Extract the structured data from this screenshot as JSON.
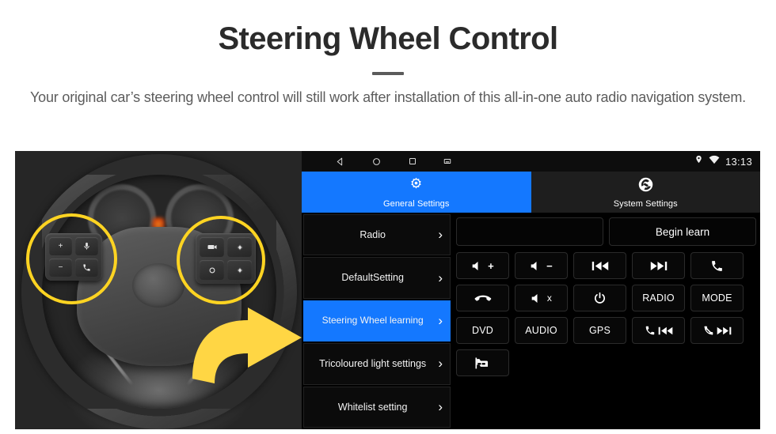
{
  "header": {
    "title": "Steering Wheel Control",
    "subtitle": "Your original car’s steering wheel control will still work after installation of this all-in-one auto radio navigation system."
  },
  "colors": {
    "accent_blue": "#1478ff",
    "highlight_yellow": "#FFD422",
    "arrow_yellow": "#FFD644",
    "screen_black": "#000000",
    "title_gray": "#2b2b2b",
    "subtitle_gray": "#5c5c5c"
  },
  "photo": {
    "caption": "steering-wheel-with-controls",
    "left_cluster_keys": [
      "+",
      "voice-assist",
      "−",
      "call"
    ],
    "right_cluster_keys": [
      "media",
      "up",
      "mode",
      "down"
    ]
  },
  "android": {
    "statusbar": {
      "nav": [
        "back-icon",
        "home-icon",
        "recents-icon",
        "screenshot-icon"
      ],
      "indicators": [
        "location-icon",
        "wifi-icon"
      ],
      "clock": "13:13"
    },
    "tabs": [
      {
        "label": "General Settings",
        "icon": "gear-icon",
        "active": true
      },
      {
        "label": "System Settings",
        "icon": "system-logo-icon",
        "active": false
      }
    ],
    "sidebar": [
      {
        "label": "Radio",
        "selected": false
      },
      {
        "label": "DefaultSetting",
        "selected": false
      },
      {
        "label": "Steering Wheel learning",
        "selected": true
      },
      {
        "label": "Tricoloured light settings",
        "selected": false
      },
      {
        "label": "Whitelist setting",
        "selected": false
      }
    ],
    "learn": {
      "display_value": "",
      "begin_label": "Begin learn"
    },
    "buttons": [
      [
        {
          "label": "",
          "icon": "volume-up-icon"
        },
        {
          "label": "",
          "icon": "volume-down-icon"
        },
        {
          "label": "",
          "icon": "previous-track-icon"
        },
        {
          "label": "",
          "icon": "next-track-icon"
        },
        {
          "label": "",
          "icon": "call-answer-icon"
        }
      ],
      [
        {
          "label": "",
          "icon": "call-hangup-icon"
        },
        {
          "label": "",
          "icon": "mute-icon"
        },
        {
          "label": "",
          "icon": "power-icon"
        },
        {
          "label": "RADIO",
          "icon": ""
        },
        {
          "label": "MODE",
          "icon": ""
        }
      ],
      [
        {
          "label": "DVD",
          "icon": ""
        },
        {
          "label": "AUDIO",
          "icon": ""
        },
        {
          "label": "GPS",
          "icon": ""
        },
        {
          "label": "",
          "icon": "call-previous-icon"
        },
        {
          "label": "",
          "icon": "hangup-next-icon"
        }
      ],
      [
        {
          "label": "",
          "icon": "car-view-icon"
        }
      ]
    ]
  }
}
